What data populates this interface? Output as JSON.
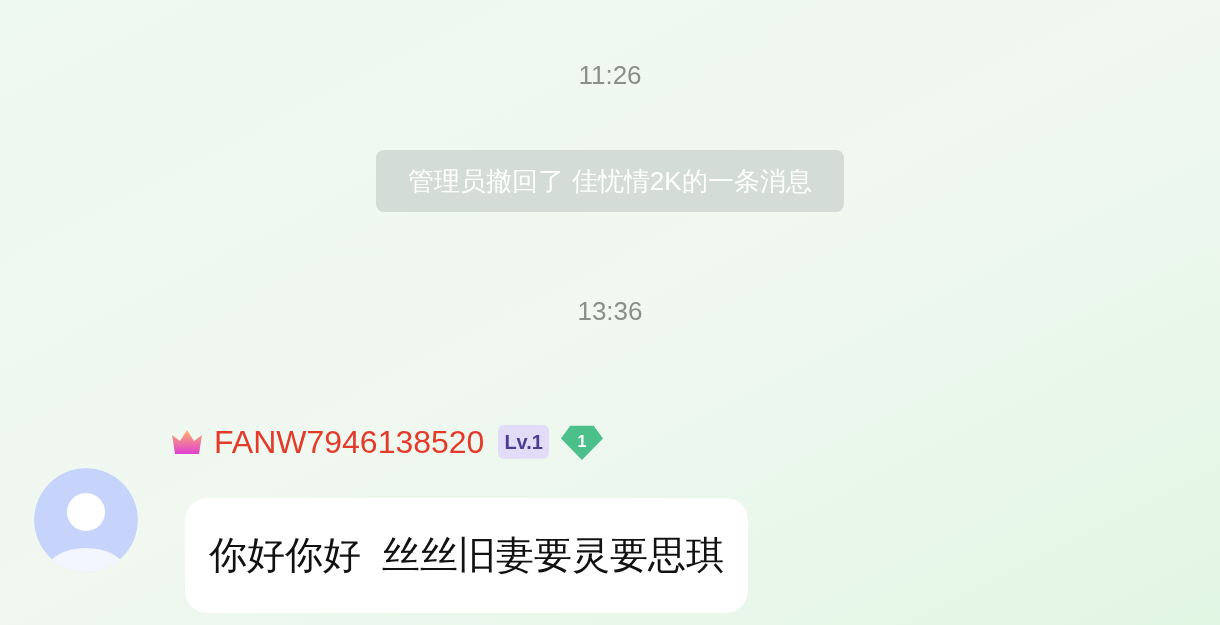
{
  "messages": [
    {
      "kind": "time",
      "text": "11:26"
    },
    {
      "kind": "notice",
      "text": "管理员撤回了 佳忧情2K的一条消息"
    },
    {
      "kind": "time",
      "text": "13:36"
    },
    {
      "kind": "message",
      "sender": "FANW7946138520",
      "level_badge": "Lv.1",
      "rank_badge": "1",
      "text": "你好你好  丝丝旧妻要灵要思琪"
    }
  ]
}
